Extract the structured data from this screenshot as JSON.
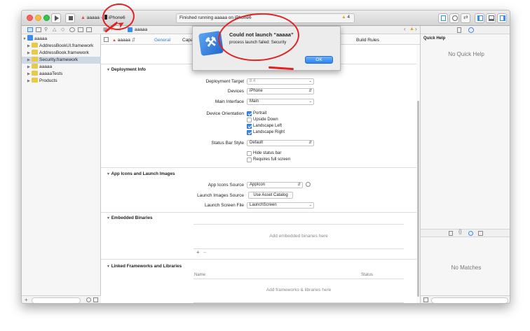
{
  "toolbar": {
    "scheme_name": "aaaaa",
    "device_name": "iPhone6",
    "status_text": "Finished running aaaaa on iPhone6",
    "warning_count": "4"
  },
  "jump_bar": {
    "project": "aaaaa"
  },
  "navigator": {
    "project_name": "aaaaa",
    "items": [
      {
        "label": "AddressBookUI.framework"
      },
      {
        "label": "AddressBook.framework"
      },
      {
        "label": "Security.framework"
      },
      {
        "label": "aaaaa"
      },
      {
        "label": "aaaaaTests"
      },
      {
        "label": "Products"
      }
    ]
  },
  "editor": {
    "target": "aaaaa",
    "tabs": [
      "General",
      "Capa",
      "Build Rules"
    ],
    "deployment": {
      "title": "Deployment Info",
      "target_label": "Deployment Target",
      "target_value": "8.4",
      "devices_label": "Devices",
      "devices_value": "iPhone",
      "main_interface_label": "Main Interface",
      "main_interface_value": "Main",
      "orientation_label": "Device Orientation",
      "orientations": [
        "Portrait",
        "Upside Down",
        "Landscape Left",
        "Landscape Right"
      ],
      "status_bar_label": "Status Bar Style",
      "status_bar_value": "Default",
      "hide_status_bar": "Hide status bar",
      "requires_full_screen": "Requires full screen"
    },
    "app_icons": {
      "title": "App Icons and Launch Images",
      "icons_source_label": "App Icons Source",
      "icons_source_value": "AppIcon",
      "launch_images_label": "Launch Images Source",
      "launch_images_button": "Use Asset Catalog",
      "launch_screen_label": "Launch Screen File",
      "launch_screen_value": "LaunchScreen"
    },
    "embedded": {
      "title": "Embedded Binaries",
      "placeholder": "Add embedded binaries here"
    },
    "linked": {
      "title": "Linked Frameworks and Libraries",
      "col_name": "Name",
      "col_status": "Status",
      "placeholder": "Add frameworks & libraries here"
    }
  },
  "inspector": {
    "quick_help_title": "Quick Help",
    "no_quick_help": "No Quick Help",
    "no_matches": "No Matches"
  },
  "alert": {
    "title": "Could not launch “aaaaa”",
    "message": "process launch failed: Security",
    "ok_label": "OK"
  },
  "colors": {
    "accent": "#3b8cf0",
    "folder_yellow": "#e9c94a",
    "selection": "#cfd9e6",
    "annotation_red": "#e32222"
  }
}
